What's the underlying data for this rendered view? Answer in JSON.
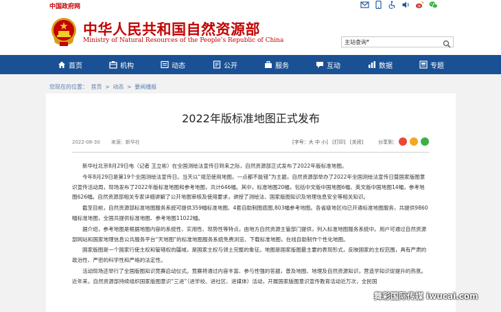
{
  "topbar": {
    "gov_link": "中国政府网",
    "icons": [
      "mail-icon",
      "phone-icon",
      "accessibility-icon",
      "audio-icon",
      "weibo-icon",
      "wechat-icon"
    ]
  },
  "header": {
    "title": "中华人民共和国自然资源部",
    "subtitle": "Ministry of Natural Resources of the People’s Republic of China",
    "search_select": "主站查询",
    "colors": {
      "brand_red": "#c40000",
      "nav_blue": "#1a5195"
    }
  },
  "nav": {
    "items": [
      {
        "label": "首页",
        "icon": "home-icon"
      },
      {
        "label": "机构",
        "icon": "institution-icon"
      },
      {
        "label": "动态",
        "icon": "news-icon"
      },
      {
        "label": "公开",
        "icon": "publish-icon"
      },
      {
        "label": "服务",
        "icon": "service-icon"
      },
      {
        "label": "互动",
        "icon": "interaction-icon"
      },
      {
        "label": "数据",
        "icon": "data-icon"
      },
      {
        "label": "专题",
        "icon": "topic-icon"
      }
    ]
  },
  "breadcrumb": {
    "prefix": "您现在的位置：",
    "items": [
      "首页",
      "动态",
      "要闻播报"
    ],
    "separator": ">"
  },
  "article": {
    "title": "2022年版标准地图正式发布",
    "date": "2022-08-30",
    "source": "来源：新华社",
    "tools": [
      "[字号：大 中 小]",
      "[打印]",
      "[关闭]"
    ],
    "share_label": "分享到：",
    "paragraphs": [
      "新华社北京8月29日电（记者 王立彬）在全国测绘法宣传日到来之际，自然资源部正式发布了2022年版标准地图。",
      "今年8月29日是第19个全国测绘法宣传日。当天以“规范使用地图，一点都不能错”为主题，自然资源部举办了2022年全国测绘法宣传日暨国家版图意识宣传活动周，现场发布了2022年版标准地图和参考地图，共计646幅。其中，标准地图20幅，包括中文版中国地图6幅、英文版中国地图14幅，参考地图626幅。自然资源部相关专家详细讲解了公开地图审核及使用要求，讲授了测绘法、国家版图知识及地理信息安全等相关知识。",
      "截至目前，自然资源部标准地图服务系统可提供359幅标准地图、4套自助制图底图,803幅参考地图。各省级地区均已开通标准地图服务，共提供9860幅标准地图，全国共提供标准地图、参考地图11022幅。",
      "据介绍，参考地图是根据地图内容的系统性、实用性、现势性等特点，由地方自然资源主管部门提供，列入标准地图服务系统中。用户可通过自然资源部网站和国家地理信息公共服务平台“天地图”的标准地图服务系统免费浏览、下载标准地图，在线自助制作个性化地图。",
      "国家版图是一个国家行使主权和管辖权的疆域，是国家主权与领土完整的象征。地图是国家版图最主要的表现形式，反映国家的主权范围，具有严肃的政治性、严密的科学性和严格的法定性。",
      "活动现场还举行了全国版图知识竞赛启动仪式。竞赛将通过内容丰富、参与性强的答题，普及地图、地理及自然资源知识，营造学知识促提升的热氛。近年来，自然资源部持续组织国家版图意识“三进”（进学校、进社区、进媒体）活动，开展国家版图意识宣传教育活动近万次，全民国"
    ]
  },
  "watermark": "舞彩国际传媒 iwucai.com"
}
